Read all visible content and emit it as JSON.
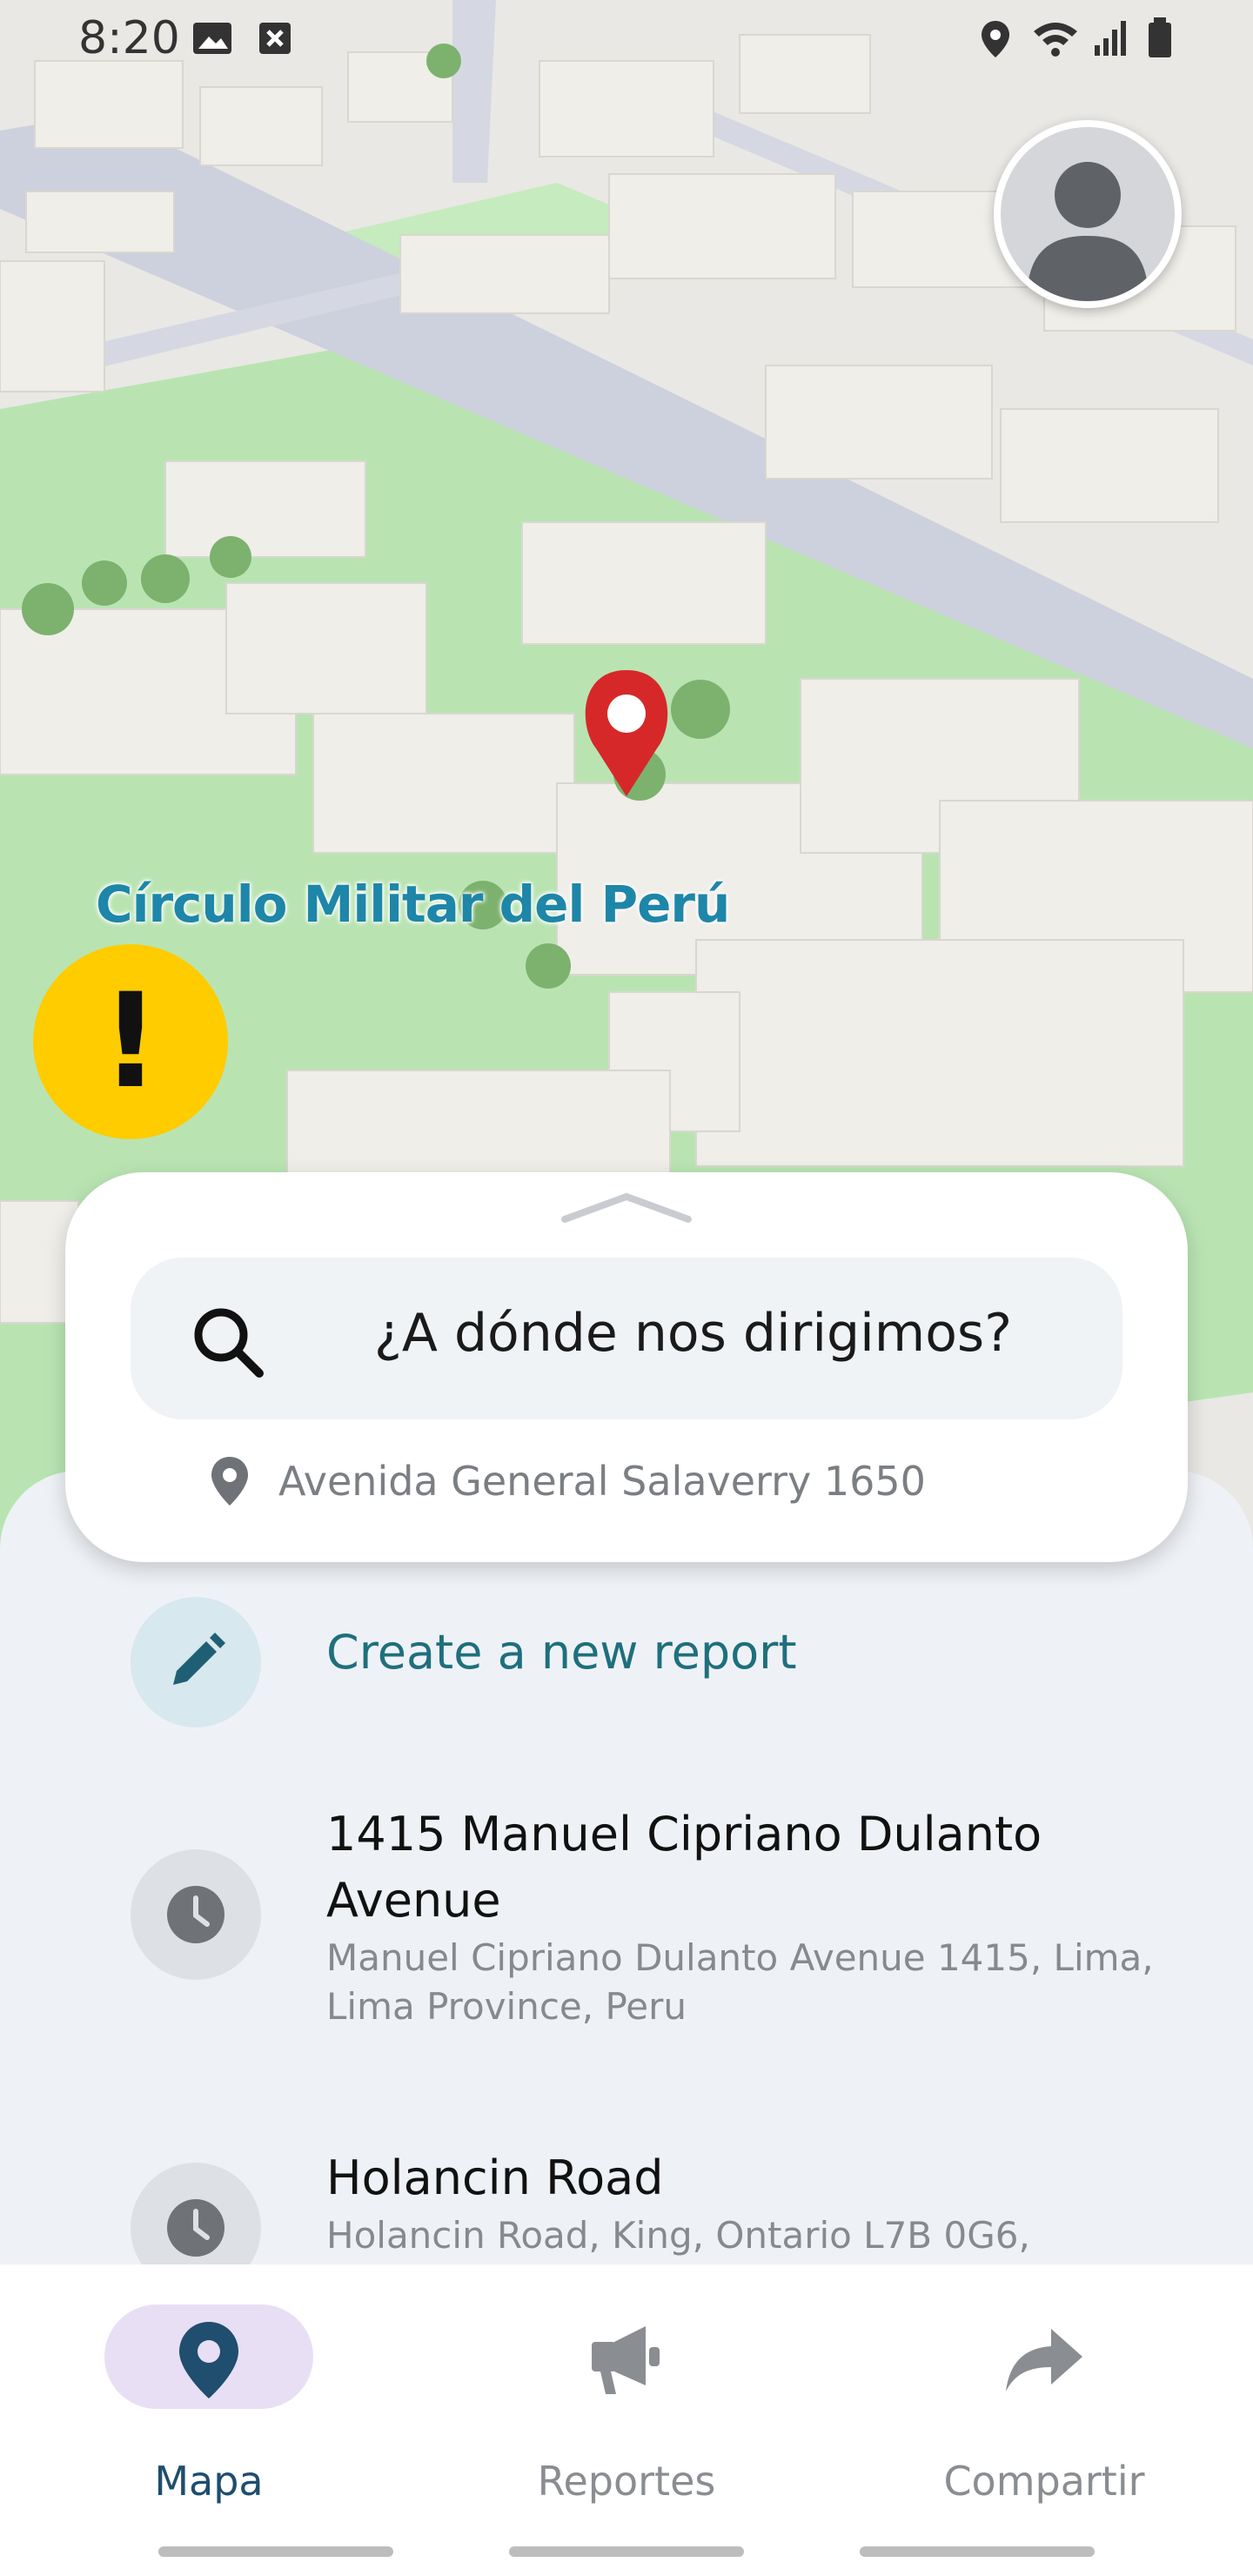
{
  "status_bar": {
    "time": "8:20"
  },
  "map": {
    "poi_label": "Círculo Militar del Perú",
    "alert_symbol": "!",
    "colors": {
      "park": "#b8e3b0",
      "buildings": "#ecebe6",
      "road": "#c9ccd8",
      "pin": "#d62828",
      "alert": "#ffcc00"
    }
  },
  "search": {
    "placeholder": "¿A dónde nos dirigimos?",
    "current_location": "Avenida General Salaverry 1650"
  },
  "list": {
    "create_label": "Create a new report",
    "recent": [
      {
        "title": "1415 Manuel Cipriano Dulanto Avenue",
        "subtitle": "Manuel Cipriano Dulanto Avenue 1415, Lima, Lima Province, Peru"
      },
      {
        "title": "Holancin Road",
        "subtitle": "Holancin Road, King, Ontario L7B 0G6,"
      }
    ]
  },
  "nav": {
    "items": [
      {
        "label": "Mapa",
        "icon": "map-pin-icon",
        "active": true
      },
      {
        "label": "Reportes",
        "icon": "megaphone-icon",
        "active": false
      },
      {
        "label": "Compartir",
        "icon": "share-arrow-icon",
        "active": false
      }
    ],
    "active_color": "#1f4e6e",
    "inactive_color": "#8a8d91"
  }
}
